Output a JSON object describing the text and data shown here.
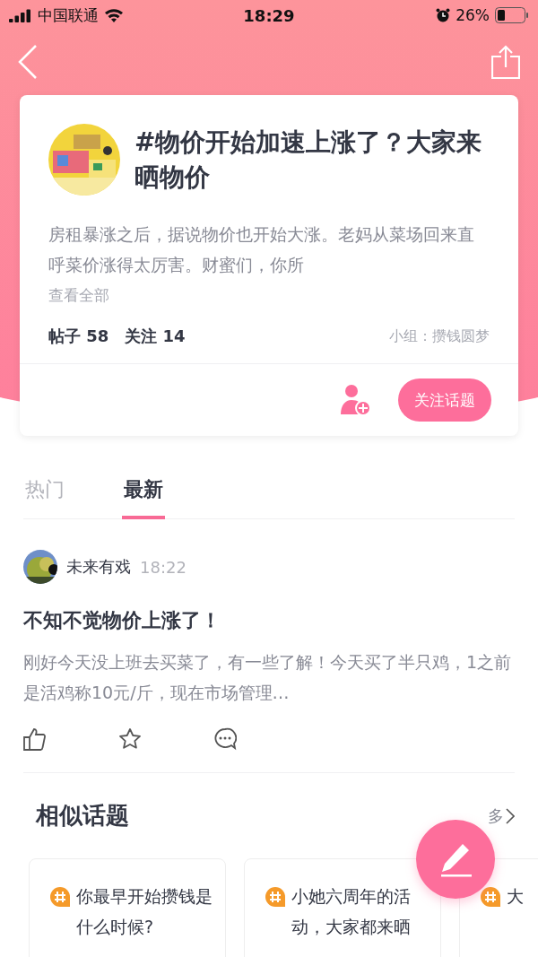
{
  "status_bar": {
    "carrier": "中国联通",
    "time": "18:29",
    "battery": "26%"
  },
  "topic": {
    "title": "#物价开始加速上涨了？大家来晒物价",
    "description": "房租暴涨之后，据说物价也开始大涨。老妈从菜场回来直呼菜价涨得太厉害。财蜜们，你所",
    "see_all": "查看全部",
    "posts": "帖子 58",
    "follows": "关注 14",
    "group": "小组：攒钱圆梦",
    "follow_button": "关注话题"
  },
  "tabs": [
    {
      "label": "热门",
      "selected": false
    },
    {
      "label": "最新",
      "selected": true
    }
  ],
  "post": {
    "author": "未来有戏",
    "time": "18:22",
    "title": "不知不觉物价上涨了！",
    "excerpt": "刚好今天没上班去买菜了，有一些了解！今天买了半只鸡，1之前是活鸡称10元/斤，现在市场管理…"
  },
  "similar": {
    "title": "相似话题",
    "more": "多",
    "topics": [
      {
        "text": "你最早开始攒钱是什么时候?"
      },
      {
        "text": "小她六周年的活动，大家都来晒"
      },
      {
        "text": "大"
      }
    ]
  }
}
